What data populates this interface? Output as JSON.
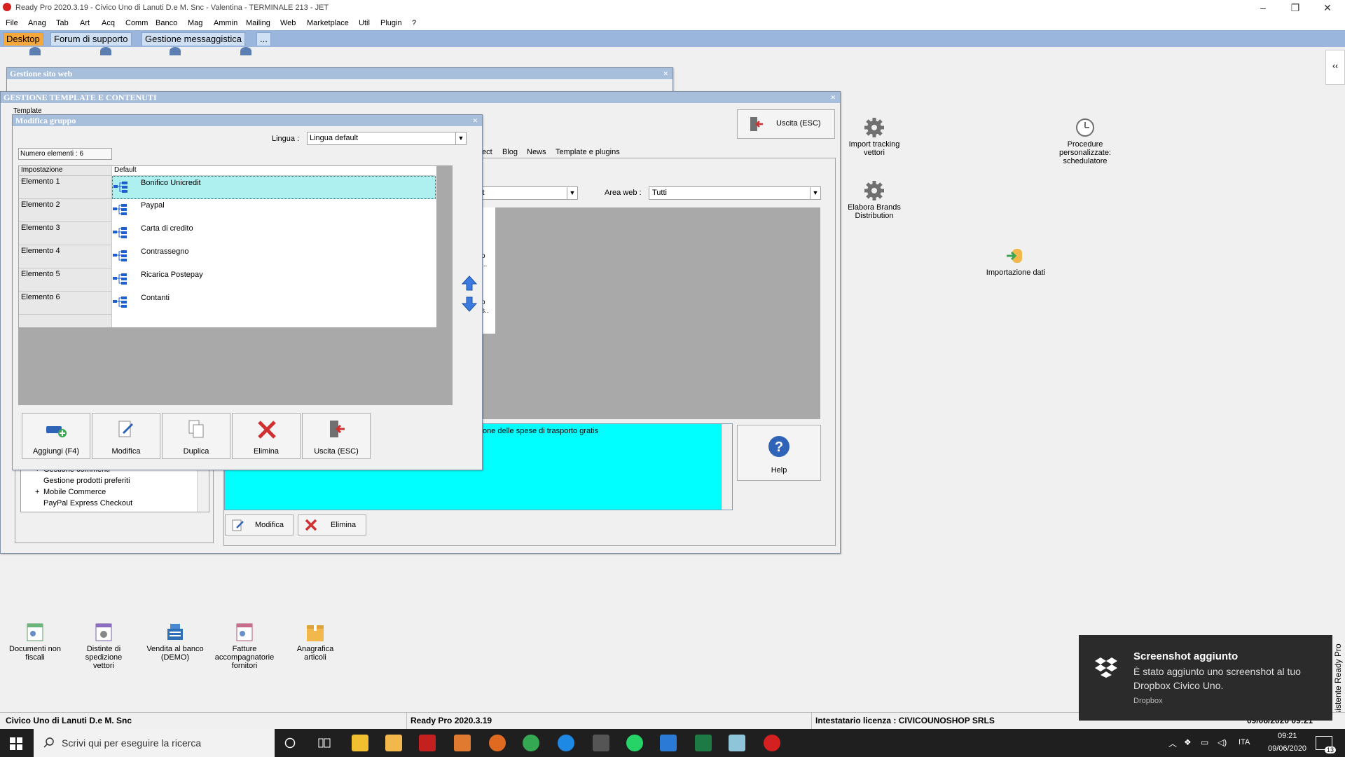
{
  "window": {
    "title": "Ready Pro 2020.3.19 - Civico Uno di Lanuti D.e M. Snc - Valentina - TERMINALE 213 - JET",
    "minimize": "–",
    "restore": "❐",
    "close": "✕"
  },
  "menu": [
    "File",
    "Anag",
    "Tab",
    "Art",
    "Acq",
    "Comm",
    "Banco",
    "Mag",
    "Ammin",
    "Mailing",
    "Web",
    "Marketplace",
    "Util",
    "Plugin",
    "?"
  ],
  "tabs": [
    {
      "label": "Desktop",
      "active": true
    },
    {
      "label": "Forum di supporto",
      "active": false
    },
    {
      "label": "Gestione messaggistica",
      "active": false
    },
    {
      "label": "...",
      "active": false
    }
  ],
  "collapse_btn": "‹‹",
  "win_sito": {
    "title": "Gestione sito web",
    "close": "×"
  },
  "win_template": {
    "title": "GESTIONE TEMPLATE E CONTENUTI",
    "close": "×",
    "template_label": "Template",
    "exit_button": "Uscita (ESC)",
    "subtabs": [
      "ect",
      "Blog",
      "News",
      "Template e plugins"
    ],
    "combo_left_value": "lt",
    "area_web_label": "Area web :",
    "area_web_value": "Tutti",
    "list_snippets": [
      "o",
      "...",
      "o",
      "s.."
    ],
    "desc_text": "one delle spese di trasporto gratis",
    "help_button": "Help",
    "bottom_buttons": {
      "modify": "Modifica",
      "delete": "Elimina"
    },
    "tree_items": [
      {
        "prefix": "+",
        "label": "Gestione commenti"
      },
      {
        "prefix": "",
        "label": "Gestione prodotti preferiti"
      },
      {
        "prefix": "+",
        "label": "Mobile Commerce"
      },
      {
        "prefix": "",
        "label": "PayPal Express Checkout"
      }
    ]
  },
  "dialog": {
    "title": "Modifica gruppo",
    "close": "×",
    "lingua_label": "Lingua :",
    "lingua_value": "Lingua default",
    "count_label": "Numero elementi : 6",
    "col_setting": "Impostazione",
    "col_default": "Default",
    "rows": [
      {
        "setting": "Elemento 1",
        "value": "Bonifico Unicredit"
      },
      {
        "setting": "Elemento 2",
        "value": "Paypal"
      },
      {
        "setting": "Elemento 3",
        "value": "Carta di credito"
      },
      {
        "setting": "Elemento 4",
        "value": "Contrassegno"
      },
      {
        "setting": "Elemento 5",
        "value": "Ricarica Postepay"
      },
      {
        "setting": "Elemento 6",
        "value": "Contanti"
      }
    ],
    "buttons": {
      "add": "Aggiungi (F4)",
      "modify": "Modifica",
      "duplicate": "Duplica",
      "delete": "Elimina",
      "exit": "Uscita (ESC)"
    }
  },
  "right_shortcuts": [
    {
      "label": "Import tracking vettori",
      "icon": "gear-icon"
    },
    {
      "label": "Procedure personalizzate: schedulatore",
      "icon": "clock-icon"
    },
    {
      "label": "Elabora Brands Distribution",
      "icon": "gear-icon"
    },
    {
      "label": "Importazione dati",
      "icon": "database-import-icon"
    }
  ],
  "bottom_shortcuts": [
    {
      "label": "Documenti non fiscali"
    },
    {
      "label": "Distinte di spedizione vettori"
    },
    {
      "label": "Vendita al banco (DEMO)"
    },
    {
      "label": "Fatture accompagnatorie fornitori"
    },
    {
      "label": "Anagrafica articoli"
    }
  ],
  "assistant_tab": "Assistente Ready Pro",
  "status": {
    "company": "Civico Uno di Lanuti D.e M. Snc",
    "version": "Ready Pro 2020.3.19",
    "license": "Intestatario licenza : CIVICOUNOSHOP SRLS",
    "datetime": "09/06/2020   09:21"
  },
  "toast": {
    "title": "Screenshot aggiunto",
    "body": "È stato aggiunto uno screenshot al tuo Dropbox Civico Uno.",
    "source": "Dropbox"
  },
  "taskbar": {
    "search_placeholder": "Scrivi qui per eseguire la ricerca",
    "lang": "ITA",
    "time": "09:21",
    "date": "09/06/2020",
    "notif_count": "13"
  },
  "colors": {
    "tab_active": "#f7a83c",
    "tabbar": "#9ab6dc",
    "selection": "#aef0f0",
    "desc_bg": "#00ffff",
    "toast_bg": "#2b2b2b",
    "taskbar_bg": "#1f1f1f"
  }
}
